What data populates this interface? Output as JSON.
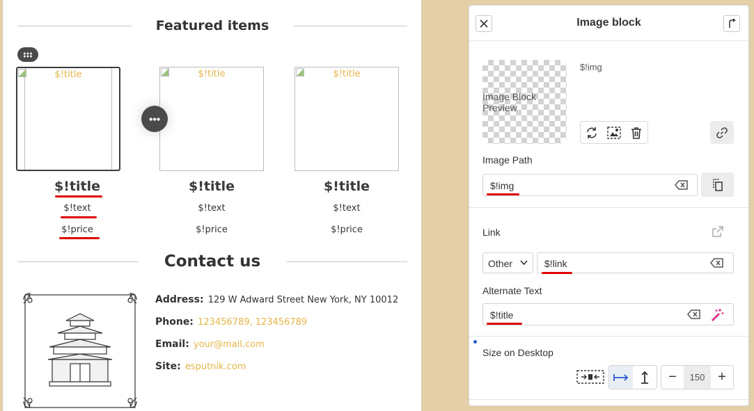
{
  "canvas": {
    "featured_heading": "Featured items",
    "contact_heading": "Contact us",
    "cards": [
      {
        "alt": "$!title",
        "title": "$!title",
        "text": "$!text",
        "price": "$!price"
      },
      {
        "alt": "$!title",
        "title": "$!title",
        "text": "$!text",
        "price": "$!price"
      },
      {
        "alt": "$!title",
        "title": "$!title",
        "text": "$!text",
        "price": "$!price"
      }
    ],
    "contact": {
      "address_label": "Address:",
      "address_value": "129 W Adward Street New York, NY 10012",
      "phone_label": "Phone:",
      "phone_1": "123456789",
      "phone_sep": ", ",
      "phone_2": "123456789",
      "email_label": "Email:",
      "email_value": "your@mail.com",
      "site_label": "Site:",
      "site_value": "esputnik.com"
    }
  },
  "panel": {
    "title": "Image block",
    "preview_alt": "Image Block Preview",
    "image_variable": "$!img",
    "image_path_label": "Image Path",
    "image_path_value": "$!img",
    "link_label": "Link",
    "link_type": "Other",
    "link_value": "$!link",
    "alt_text_label": "Alternate Text",
    "alt_text_value": "$!title",
    "size_label": "Size on Desktop",
    "size_value": "150"
  },
  "colors": {
    "accent_gold": "#e4b547",
    "highlight_red": "#e00000",
    "page_background": "#e3cfa8",
    "active_blue": "#2a5bd7"
  },
  "icons": [
    "drag-handle-icon",
    "more-options-icon",
    "close-icon",
    "collapse-icon",
    "replace-image-icon",
    "crop-icon",
    "trash-icon",
    "link-icon",
    "clear-icon",
    "copy-icon",
    "external-link-icon",
    "magic-wand-icon",
    "auto-size-icon",
    "fit-width-icon",
    "fit-height-icon",
    "chevron-down-icon"
  ]
}
